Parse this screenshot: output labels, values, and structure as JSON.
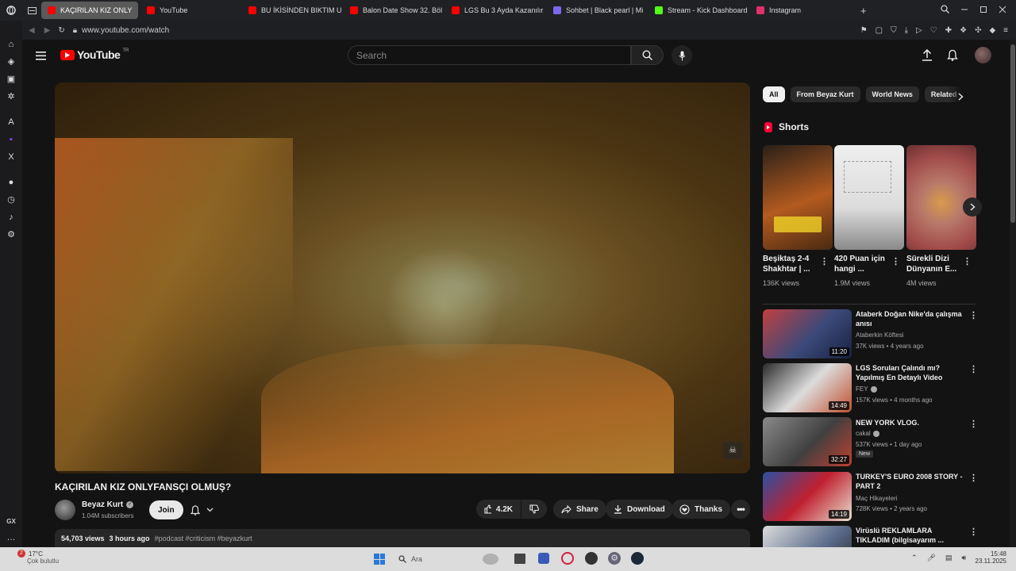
{
  "tabs": [
    {
      "label": "KAÇIRILAN KIZ ONLY",
      "active": true,
      "color": "#ff0000"
    },
    {
      "label": "YouTube",
      "color": "#ff0000"
    },
    {
      "label": "BU İKİSİNDEN BIKTIM UL",
      "color": "#ff0000"
    },
    {
      "label": "Balon Date Show 32. Böl",
      "color": "#ff0000"
    },
    {
      "label": "LGS Bu 3 Ayda Kazanılır",
      "color": "#ff0000"
    },
    {
      "label": "Sohbet | Black pearl | Mi",
      "color": "#7b68ee"
    },
    {
      "label": "Stream - Kick Dashboard",
      "color": "#53fc18"
    },
    {
      "label": "Instagram",
      "color": "#e1306c"
    }
  ],
  "address": "www.youtube.com/watch",
  "yt": {
    "logo_text": "YouTube",
    "logo_sup": "TR",
    "search_placeholder": "Search"
  },
  "video": {
    "title": "KAÇIRILAN KIZ ONLYFANSÇI OLMUŞ?",
    "channel": "Beyaz Kurt",
    "subscribers": "1.04M subscribers",
    "join": "Join",
    "likes": "4.2K",
    "share": "Share",
    "download": "Download",
    "thanks": "Thanks",
    "views": "54,703 views",
    "age": "3 hours ago",
    "tags": "#podcast #criticism #beyazkurt"
  },
  "chips": [
    "All",
    "From Beyaz Kurt",
    "World News",
    "Related"
  ],
  "shorts": {
    "heading": "Shorts",
    "items": [
      {
        "title": "Beşiktaş 2-4 Shakhtar | ...",
        "views": "136K views",
        "color": "#b35a1f"
      },
      {
        "title": "420 Puan için hangi ...",
        "views": "1.9M views",
        "color": "#d9d9d9"
      },
      {
        "title": "Sürekli Dizi Dünyanın E...",
        "views": "4M views",
        "color": "#b97a6a"
      }
    ]
  },
  "recommendations": [
    {
      "title": "Ataberk Doğan Nike'da çalışma anısı",
      "channel": "Ataberkin Köftesi",
      "meta": "37K views • 4 years ago",
      "duration": "11:20",
      "verified": false,
      "badge": "",
      "color": "#3b4a7a"
    },
    {
      "title": "LGS Soruları Çalındı mı? Yapılmış En Detaylı Video",
      "channel": "FEY",
      "meta": "157K views • 4 months ago",
      "duration": "14:49",
      "verified": true,
      "badge": "",
      "color": "#c05030"
    },
    {
      "title": "NEW YORK VLOG.",
      "channel": "cakal",
      "meta": "537K views • 1 day ago",
      "duration": "32:27",
      "verified": true,
      "badge": "New",
      "color": "#404040"
    },
    {
      "title": "TURKEY'S EURO 2008 STORY - PART 2",
      "channel": "Maç Hikayeleri",
      "meta": "728K views • 2 years ago",
      "duration": "14:19",
      "verified": false,
      "badge": "",
      "color": "#c02030"
    },
    {
      "title": "Virüslü REKLAMLARA TIKLADIM (bilgisayarım ...",
      "channel": "",
      "meta": "",
      "duration": "",
      "verified": false,
      "badge": "",
      "color": "#5a6a8a"
    }
  ],
  "taskbar": {
    "weather_temp": "17°C",
    "weather_desc": "Çok bulutlu",
    "search": "Ara",
    "time": "15:48",
    "date": "23.11.2025",
    "notif": "2"
  },
  "sidebar_label": "GX"
}
